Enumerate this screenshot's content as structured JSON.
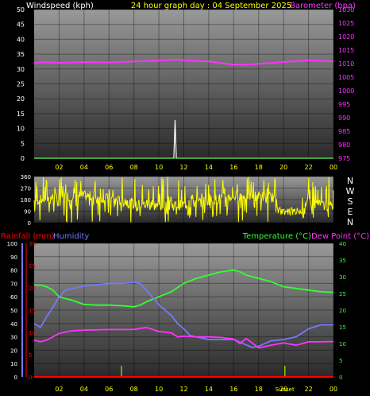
{
  "colors": {
    "background": "#000000",
    "plot_top": "#999999",
    "plot_bottom": "#2a2a2a",
    "wind": "#ffffff",
    "barometer": "#ff33ff",
    "direction": "#ffff00",
    "rainfall": "#ff0000",
    "humidity": "#7777ff",
    "temperature": "#33ff33",
    "dewpoint": "#ff33ff",
    "title": "#ffff00",
    "axis_text": "#ffffff",
    "x_axis_text": "#ffff00"
  },
  "header": {
    "windspeed_label": "Windspeed (kph)",
    "title": "24 hour graph day : 04 September 2025",
    "barometer_label": "Barometer (hpa)"
  },
  "bottom_header": {
    "rainfall_label": "Rainfall (mm)",
    "humidity_label": "Humidity",
    "temperature_label": "Temperature (°C)",
    "dewpoint_label": "Dew Point (°C)"
  },
  "sunset_label": "Sunset",
  "chart_data": [
    {
      "type": "line",
      "id": "wind-barometer",
      "x_ticks": [
        "02",
        "04",
        "06",
        "08",
        "10",
        "12",
        "14",
        "16",
        "18",
        "20",
        "22",
        "00"
      ],
      "xlim": [
        0,
        24
      ],
      "y_left": {
        "label": "Windspeed (kph)",
        "ticks": [
          0,
          5,
          10,
          15,
          20,
          25,
          30,
          35,
          40,
          45,
          50
        ],
        "lim": [
          0,
          50
        ]
      },
      "y_right": {
        "label": "Barometer (hpa)",
        "ticks": [
          975,
          980,
          985,
          990,
          995,
          1000,
          1005,
          1010,
          1015,
          1020,
          1025,
          1030
        ],
        "lim": [
          975,
          1030
        ]
      },
      "series": [
        {
          "name": "Windspeed",
          "axis": "left",
          "x": [
            0,
            11.2,
            11.3,
            11.4,
            24
          ],
          "y": [
            0,
            0,
            12.7,
            0,
            0
          ]
        },
        {
          "name": "Barometer",
          "axis": "right",
          "x": [
            0,
            1,
            2,
            4,
            6,
            8,
            10,
            11.5,
            12,
            14,
            16,
            17,
            18,
            20,
            22,
            24
          ],
          "y": [
            1010.3,
            1010.5,
            1010.3,
            1010.5,
            1010.4,
            1010.8,
            1011.1,
            1011.5,
            1011.2,
            1010.8,
            1009.6,
            1009.6,
            1009.9,
            1010.6,
            1011.2,
            1010.8
          ]
        }
      ],
      "grid": true
    },
    {
      "type": "line",
      "id": "wind-direction",
      "y_ticks": [
        0,
        90,
        180,
        270,
        360
      ],
      "lim": [
        0,
        360
      ],
      "compass": [
        "N",
        "W",
        "S",
        "E",
        "N"
      ],
      "grid": true
    },
    {
      "type": "line",
      "id": "temperature-humidity",
      "x_ticks": [
        "02",
        "04",
        "06",
        "08",
        "10",
        "12",
        "14",
        "16",
        "18",
        "20",
        "22",
        "00"
      ],
      "xlim": [
        0,
        24
      ],
      "y_humidity": {
        "label": "Humidity",
        "ticks": [
          0,
          10,
          20,
          30,
          40,
          50,
          60,
          70,
          80,
          90,
          100
        ],
        "lim": [
          0,
          100
        ]
      },
      "y_rainfall": {
        "label": "Rainfall (mm)",
        "ticks": [
          0,
          5,
          10,
          15,
          20,
          25,
          30
        ],
        "lim": [
          0,
          30
        ]
      },
      "y_temperature": {
        "label": "Temperature (°C)",
        "ticks": [
          0,
          5,
          10,
          15,
          20,
          25,
          30,
          35,
          40
        ],
        "lim": [
          0,
          40
        ]
      },
      "series": [
        {
          "name": "Temperature",
          "axis": "temperature",
          "x": [
            0,
            0.5,
            1,
            1.5,
            2,
            3,
            4,
            5,
            6,
            7,
            8,
            8.5,
            9,
            10,
            11,
            12,
            13,
            14,
            15,
            16,
            16.5,
            17,
            18,
            19,
            20,
            21,
            22,
            23,
            24
          ],
          "y": [
            27.5,
            27.5,
            27,
            26,
            24,
            23,
            21.7,
            21.5,
            21.5,
            21.3,
            21,
            21.5,
            22.5,
            24,
            25.5,
            28,
            29.5,
            30.5,
            31.5,
            32,
            31.5,
            30.5,
            29.5,
            28.5,
            27,
            26.5,
            26,
            25.5,
            25.3
          ]
        },
        {
          "name": "Humidity",
          "axis": "humidity",
          "x": [
            0,
            0.5,
            1,
            1.5,
            2,
            2.5,
            3,
            4,
            5,
            6,
            7,
            8,
            8.5,
            9,
            10,
            11,
            11.5,
            12,
            12.5,
            13,
            14,
            15,
            16,
            17,
            17.5,
            18,
            19,
            20,
            21,
            22,
            23,
            24
          ],
          "y": [
            40,
            37,
            45,
            52,
            60,
            65,
            66,
            68,
            69,
            70,
            70,
            71,
            70,
            65,
            54,
            46,
            40,
            36,
            31,
            30,
            28,
            28,
            28,
            24,
            22,
            23,
            27,
            28,
            30,
            36,
            39,
            39
          ]
        },
        {
          "name": "Dew Point",
          "axis": "temperature",
          "x": [
            0,
            0.5,
            1,
            1.5,
            2,
            3,
            4,
            6,
            8,
            9,
            10,
            11,
            11.5,
            12,
            13,
            14,
            15,
            16,
            16.5,
            17,
            18,
            19,
            20,
            21,
            22,
            23,
            24
          ],
          "y": [
            11,
            10.5,
            11,
            12,
            13,
            13.8,
            14,
            14.2,
            14.2,
            14.8,
            13.6,
            13.2,
            12,
            12.2,
            12,
            12,
            11.8,
            11.3,
            10,
            11.5,
            8.7,
            9.5,
            10.2,
            9.5,
            10.5,
            10.5,
            10.6
          ]
        },
        {
          "name": "Rainfall",
          "axis": "rainfall",
          "x": [
            0,
            24
          ],
          "y": [
            0,
            0
          ]
        }
      ],
      "markers": [
        7,
        20.1
      ],
      "grid": true
    }
  ]
}
